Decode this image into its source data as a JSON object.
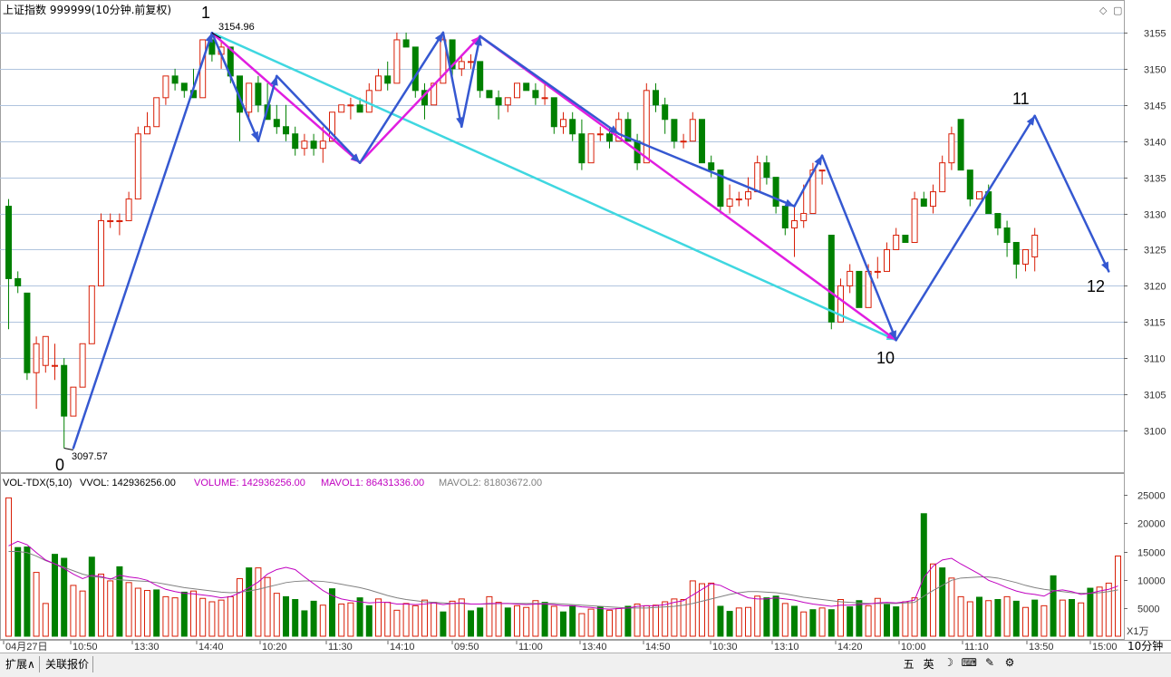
{
  "header": {
    "title": "上证指数 999999(10分钟.前复权)",
    "vol_label": "VOL-TDX(5,10)",
    "vvol": "VVOL: 142936256.00",
    "volume": "VOLUME: 142936256.00",
    "mavol1": "MAVOL1: 86431336.00",
    "mavol2": "MAVOL2: 81803672.00",
    "volume_unit": "X1万",
    "period": "10分钟"
  },
  "tabs": [
    "扩展∧",
    "关联报价"
  ],
  "ime_icons": [
    "五",
    "英",
    "☽",
    "⌨",
    "✎",
    "⚙"
  ],
  "colors": {
    "up": "#d81e06",
    "down": "#008000",
    "grid": "#b0c4de",
    "blue": "#3558d1",
    "magenta": "#e01ee0",
    "cyan": "#3fd7e0",
    "ma1": "#c000c0",
    "ma2": "#808080"
  },
  "chart_data": [
    {
      "type": "candlestick",
      "y_ticks": [
        3100,
        3105,
        3110,
        3115,
        3120,
        3125,
        3130,
        3135,
        3140,
        3145,
        3150,
        3155
      ],
      "ylim": [
        3095,
        3158
      ],
      "x_labels": [
        "04月27日",
        "10:50",
        "13:30",
        "14:40",
        "10:20",
        "11:30",
        "14:10",
        "09:50",
        "11:00",
        "13:40",
        "14:50",
        "10:30",
        "13:10",
        "14:20",
        "10:00",
        "11:10",
        "13:50",
        "15:00"
      ],
      "annotations": {
        "high_value": "3154.96",
        "low_value": "3097.57",
        "points": [
          "0",
          "1",
          "10",
          "11",
          "12"
        ]
      },
      "ohlc": [
        [
          3131,
          3132,
          3114,
          3121
        ],
        [
          3121,
          3122,
          3119,
          3120
        ],
        [
          3119,
          3119,
          3107,
          3108
        ],
        [
          3108,
          3113,
          3103,
          3112
        ],
        [
          3109,
          3113,
          3108,
          3113
        ],
        [
          3109,
          3112,
          3107,
          3109
        ],
        [
          3109,
          3110,
          3097.57,
          3102
        ],
        [
          3102,
          3106,
          3102,
          3106
        ],
        [
          3106,
          3112,
          3106,
          3112
        ],
        [
          3112,
          3120,
          3112,
          3120
        ],
        [
          3120,
          3130,
          3120,
          3129
        ],
        [
          3129,
          3130,
          3128,
          3129
        ],
        [
          3129,
          3130,
          3127,
          3129
        ],
        [
          3129,
          3133,
          3129,
          3132
        ],
        [
          3132,
          3142,
          3132,
          3141
        ],
        [
          3141,
          3144,
          3141,
          3142
        ],
        [
          3142,
          3146,
          3142,
          3146
        ],
        [
          3146,
          3149,
          3145,
          3149
        ],
        [
          3149,
          3150,
          3147,
          3148
        ],
        [
          3148,
          3148,
          3146,
          3147
        ],
        [
          3147,
          3150,
          3146,
          3146
        ],
        [
          3146,
          3154,
          3146,
          3154
        ],
        [
          3154,
          3154.96,
          3151,
          3152
        ],
        [
          3152,
          3154,
          3150,
          3153
        ],
        [
          3153,
          3153,
          3148,
          3149
        ],
        [
          3149,
          3149,
          3140,
          3144
        ],
        [
          3144,
          3148,
          3143,
          3148
        ],
        [
          3148,
          3149,
          3144,
          3145
        ],
        [
          3145,
          3148,
          3143,
          3143
        ],
        [
          3143,
          3145,
          3141,
          3142
        ],
        [
          3142,
          3145,
          3140,
          3141
        ],
        [
          3141,
          3142,
          3138,
          3139
        ],
        [
          3139,
          3141,
          3138,
          3140
        ],
        [
          3140,
          3141,
          3138,
          3139
        ],
        [
          3139,
          3142,
          3137,
          3140
        ],
        [
          3140,
          3144,
          3140,
          3144
        ],
        [
          3144,
          3145,
          3144,
          3145
        ],
        [
          3145,
          3146,
          3143,
          3145
        ],
        [
          3145,
          3146,
          3144,
          3144
        ],
        [
          3144,
          3148,
          3144,
          3147
        ],
        [
          3147,
          3150,
          3147,
          3149
        ],
        [
          3149,
          3151,
          3147,
          3148
        ],
        [
          3148,
          3155,
          3148,
          3154
        ],
        [
          3154,
          3155,
          3153,
          3153
        ],
        [
          3153,
          3153,
          3146,
          3147
        ],
        [
          3147,
          3148,
          3143,
          3145
        ],
        [
          3145,
          3148,
          3145,
          3148
        ],
        [
          3148,
          3155,
          3148,
          3154
        ],
        [
          3154,
          3154,
          3149,
          3150
        ],
        [
          3150,
          3152,
          3149,
          3151
        ],
        [
          3151,
          3152,
          3150,
          3151
        ],
        [
          3151,
          3151,
          3146,
          3147
        ],
        [
          3147,
          3147,
          3146,
          3146
        ],
        [
          3146,
          3147,
          3143,
          3145
        ],
        [
          3145,
          3146,
          3144,
          3146
        ],
        [
          3146,
          3148,
          3146,
          3148
        ],
        [
          3148,
          3148,
          3147,
          3147
        ],
        [
          3147,
          3148,
          3145,
          3146
        ],
        [
          3146,
          3148,
          3145,
          3146
        ],
        [
          3146,
          3146,
          3141,
          3142
        ],
        [
          3142,
          3144,
          3141,
          3143
        ],
        [
          3143,
          3144,
          3140,
          3141
        ],
        [
          3141,
          3143,
          3136,
          3137
        ],
        [
          3137,
          3141,
          3137,
          3141
        ],
        [
          3141,
          3142,
          3140,
          3141
        ],
        [
          3141,
          3142,
          3139,
          3140
        ],
        [
          3140,
          3144,
          3140,
          3143
        ],
        [
          3143,
          3144,
          3140,
          3140
        ],
        [
          3140,
          3141,
          3136,
          3137
        ],
        [
          3137,
          3148,
          3137,
          3147
        ],
        [
          3147,
          3148,
          3144,
          3145
        ],
        [
          3145,
          3146,
          3141,
          3143
        ],
        [
          3143,
          3143,
          3139,
          3140
        ],
        [
          3140,
          3141,
          3139,
          3140
        ],
        [
          3140,
          3144,
          3140,
          3143
        ],
        [
          3143,
          3143,
          3137,
          3137
        ],
        [
          3137,
          3138,
          3135,
          3136
        ],
        [
          3136,
          3136,
          3130,
          3131
        ],
        [
          3131,
          3134,
          3130,
          3132
        ],
        [
          3132,
          3133,
          3131,
          3132
        ],
        [
          3132,
          3135,
          3131,
          3133
        ],
        [
          3133,
          3138,
          3133,
          3137
        ],
        [
          3137,
          3138,
          3134,
          3135
        ],
        [
          3135,
          3135,
          3130,
          3131
        ],
        [
          3131,
          3131,
          3127,
          3128
        ],
        [
          3128,
          3131,
          3124,
          3129
        ],
        [
          3129,
          3134,
          3128,
          3130
        ],
        [
          3130,
          3137,
          3130,
          3136
        ],
        [
          3136,
          3136,
          3134,
          3136
        ],
        [
          3127,
          3127,
          3114,
          3115
        ],
        [
          3115,
          3121,
          3115,
          3120
        ],
        [
          3120,
          3123,
          3119,
          3122
        ],
        [
          3122,
          3122,
          3117,
          3117
        ],
        [
          3117,
          3123,
          3117,
          3122
        ],
        [
          3122,
          3124,
          3121,
          3122
        ],
        [
          3122,
          3126,
          3122,
          3125
        ],
        [
          3125,
          3128,
          3125,
          3127
        ],
        [
          3127,
          3127,
          3126,
          3126
        ],
        [
          3126,
          3133,
          3126,
          3132
        ],
        [
          3132,
          3133,
          3131,
          3131
        ],
        [
          3131,
          3134,
          3130,
          3133
        ],
        [
          3133,
          3138,
          3133,
          3137
        ],
        [
          3137,
          3142,
          3136,
          3141
        ],
        [
          3143,
          3143,
          3137,
          3136
        ],
        [
          3136,
          3136,
          3131,
          3132
        ],
        [
          3132,
          3133,
          3132,
          3133
        ],
        [
          3133,
          3134,
          3130,
          3130
        ],
        [
          3130,
          3130,
          3127,
          3128
        ],
        [
          3128,
          3129,
          3124,
          3126
        ],
        [
          3126,
          3126,
          3121,
          3123
        ],
        [
          3123,
          3125,
          3122,
          3125
        ],
        [
          3124,
          3128,
          3122,
          3127
        ]
      ],
      "zigzag_blue": [
        [
          7,
          3097.57
        ],
        [
          22,
          3154.96
        ],
        [
          27,
          3140
        ],
        [
          29,
          3149
        ],
        [
          38,
          3137
        ],
        [
          47,
          3155
        ],
        [
          49,
          3142
        ],
        [
          51,
          3154.5
        ],
        [
          66,
          3141
        ],
        [
          85,
          3131
        ],
        [
          88,
          3138
        ],
        [
          96,
          3112.5
        ],
        [
          111,
          3143.5
        ],
        [
          119,
          3122
        ]
      ],
      "zigzag_magenta": [
        [
          22,
          3154.96
        ],
        [
          38,
          3137
        ],
        [
          51,
          3154.5
        ],
        [
          96,
          3112.5
        ]
      ],
      "zigzag_cyan": [
        [
          22,
          3154.96
        ],
        [
          96,
          3112.5
        ]
      ]
    },
    {
      "type": "bar",
      "y_ticks": [
        5000,
        10000,
        15000,
        20000,
        25000
      ],
      "ylim": [
        0,
        26000
      ],
      "volume": [
        24500,
        15700,
        15800,
        11300,
        5800,
        14500,
        13800,
        9000,
        8000,
        14000,
        11000,
        9800,
        12300,
        9500,
        8500,
        8100,
        8200,
        7000,
        6800,
        7800,
        8000,
        6700,
        6100,
        6400,
        7000,
        10200,
        12100,
        12100,
        10400,
        7600,
        7000,
        6500,
        4500,
        6200,
        5500,
        8400,
        5700,
        5900,
        6800,
        5400,
        6600,
        6000,
        4600,
        5800,
        5400,
        6400,
        6000,
        4300,
        6200,
        6600,
        4500,
        5000,
        7000,
        6000,
        5000,
        5400,
        5100,
        6300,
        6000,
        5300,
        4300,
        5400,
        4000,
        4800,
        5200,
        4600,
        4900,
        5300,
        5700,
        5400,
        5500,
        6100,
        6600,
        6500,
        9800,
        9300,
        9400,
        5300,
        4400,
        5000,
        5100,
        7100,
        6800,
        7100,
        5800,
        5300,
        4300,
        4700,
        5000,
        4700,
        6500,
        5200,
        6300,
        5400,
        6700,
        5600,
        5200,
        6100,
        6800,
        21700,
        12800,
        12100,
        10300,
        7000,
        6100,
        6900,
        6300,
        6500,
        7000,
        6200,
        5100,
        6400,
        5400,
        10700,
        6400,
        6500,
        5900,
        8500,
        8700,
        9400,
        14200
      ],
      "vol_up": [
        true,
        false,
        false,
        true,
        true,
        false,
        false,
        true,
        true,
        false,
        true,
        true,
        false,
        true,
        true,
        true,
        false,
        true,
        true,
        false,
        true,
        true,
        true,
        true,
        true,
        true,
        false,
        true,
        true,
        true,
        false,
        false,
        false,
        false,
        true,
        false,
        true,
        true,
        false,
        false,
        true,
        true,
        true,
        true,
        true,
        true,
        true,
        false,
        true,
        true,
        false,
        false,
        true,
        true,
        false,
        true,
        true,
        true,
        false,
        true,
        false,
        false,
        true,
        true,
        false,
        true,
        true,
        false,
        true,
        true,
        true,
        true,
        true,
        true,
        true,
        true,
        true,
        false,
        false,
        true,
        true,
        true,
        false,
        false,
        true,
        false,
        true,
        false,
        true,
        false,
        true,
        false,
        false,
        true,
        true,
        false,
        false,
        true,
        true,
        false,
        true,
        false,
        true,
        true,
        true,
        false,
        true,
        false,
        true,
        false,
        true,
        false,
        true,
        false,
        true,
        false,
        true,
        false,
        true,
        true,
        true
      ],
      "mavol1": [
        16000,
        16800,
        16200,
        14800,
        13500,
        12800,
        12000,
        11000,
        10200,
        10800,
        10600,
        10100,
        10800,
        10500,
        10300,
        9900,
        9000,
        8300,
        7900,
        7600,
        7500,
        7300,
        7100,
        6800,
        7000,
        7700,
        8600,
        9600,
        11000,
        11800,
        12200,
        11800,
        10500,
        9300,
        8100,
        7200,
        6600,
        6300,
        6100,
        5900,
        6000,
        6000,
        5700,
        5700,
        5600,
        5700,
        5900,
        5600,
        5800,
        5900,
        5700,
        5700,
        5800,
        5800,
        5800,
        5700,
        5600,
        5700,
        5700,
        5600,
        5400,
        5400,
        5200,
        5100,
        4900,
        4800,
        4900,
        5000,
        5300,
        5400,
        5400,
        5600,
        6000,
        6300,
        7300,
        8300,
        9300,
        9000,
        8200,
        7500,
        6800,
        6600,
        6600,
        6800,
        6600,
        6400,
        6000,
        5700,
        5500,
        5300,
        5500,
        5500,
        5600,
        5700,
        5900,
        6000,
        5900,
        6100,
        6400,
        10400,
        12400,
        13500,
        13800,
        12800,
        11900,
        11000,
        9900,
        9300,
        8600,
        8000,
        7600,
        7400,
        7100,
        8000,
        8200,
        7900,
        7400,
        7600,
        8000,
        8300,
        8900
      ],
      "mavol2": [
        15000,
        15000,
        14800,
        14200,
        13400,
        12800,
        12200,
        11600,
        11000,
        10600,
        10400,
        10200,
        10000,
        9900,
        9800,
        9700,
        9500,
        9200,
        8900,
        8600,
        8400,
        8200,
        8000,
        7800,
        7700,
        7800,
        8000,
        8300,
        8700,
        9100,
        9500,
        9700,
        9800,
        9800,
        9700,
        9500,
        9200,
        8900,
        8600,
        8200,
        7700,
        7200,
        6800,
        6500,
        6300,
        6100,
        6000,
        5900,
        5800,
        5800,
        5700,
        5700,
        5700,
        5800,
        5800,
        5800,
        5800,
        5800,
        5800,
        5800,
        5700,
        5600,
        5500,
        5400,
        5300,
        5200,
        5100,
        5000,
        5000,
        5000,
        5100,
        5200,
        5300,
        5500,
        5800,
        6200,
        6600,
        7000,
        7400,
        7700,
        7900,
        7900,
        7800,
        7700,
        7500,
        7200,
        6900,
        6700,
        6500,
        6300,
        6100,
        6000,
        5900,
        5800,
        5800,
        5800,
        5800,
        5900,
        6000,
        7100,
        8100,
        9000,
        9900,
        10300,
        10400,
        10500,
        10500,
        10300,
        9900,
        9500,
        9000,
        8600,
        8300,
        8100,
        7900,
        7700,
        7600,
        7600,
        7700,
        7900,
        8200
      ]
    }
  ]
}
